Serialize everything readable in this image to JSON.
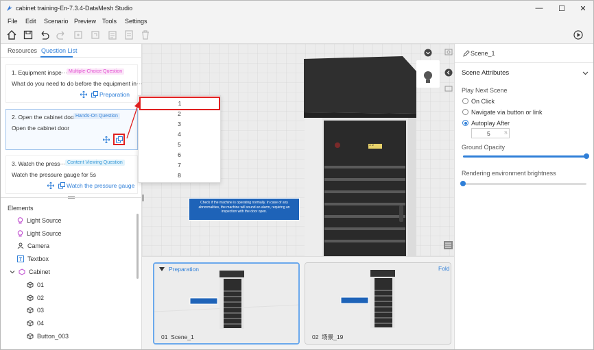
{
  "window": {
    "title": "cabinet training-En-7.3.4-DataMesh Studio",
    "minimize": "—",
    "maximize": "☐",
    "close": "✕"
  },
  "menu": [
    "File",
    "Edit",
    "Scenario",
    "Preview",
    "Tools",
    "Settings"
  ],
  "tabs": {
    "resources": "Resources",
    "question_list": "Question List"
  },
  "questions": [
    {
      "title": "1. Equipment inspe···",
      "tag": "Multiple-Choice Question",
      "text": "What do you need to do before the equipment in···",
      "action": "Preparation"
    },
    {
      "title": "2. Open the cabinet door",
      "tag": "Hands-On Question",
      "text": "Open the cabinet door",
      "action": ""
    },
    {
      "title": "3. Watch the press···",
      "tag": "Content Viewing Question",
      "text": "Watch the pressure gauge for 5s",
      "action": "Watch the pressure gauge"
    }
  ],
  "elements": {
    "header": "Elements",
    "items": [
      "Light Source",
      "Light Source",
      "Camera",
      "Textbox",
      "Cabinet",
      "01",
      "02",
      "03",
      "04",
      "Button_003"
    ]
  },
  "dropdown": [
    "1",
    "2",
    "3",
    "4",
    "5",
    "6",
    "7",
    "8"
  ],
  "viewport": {
    "info_text": "Check if the machine is operating normally. In case of any abnormalities, the machine will sound an alarm, requiring an inspection with the door open.",
    "label": "1 2"
  },
  "thumbnails": [
    {
      "tag": "Preparation",
      "caption": "01  Scene_1"
    },
    {
      "tag": "Fold",
      "caption": "02  场景_19"
    }
  ],
  "right": {
    "scene_name": "Scene_1",
    "section": "Scene Attributes",
    "play_next": "Play Next Scene",
    "options": [
      "On Click",
      "Navigate via button or link",
      "Autoplay After"
    ],
    "selected_option": "Autoplay After",
    "autoplay_value": "5",
    "autoplay_unit": "S",
    "ground_opacity": "Ground Opacity",
    "ground_opacity_value": 1.0,
    "brightness": "Rendering environment brightness",
    "brightness_value": 0.0
  },
  "colors": {
    "accent": "#2f7fd8",
    "highlight": "#e02020",
    "tag_pink": "#e24ad0",
    "tag_blue": "#3b86d8"
  }
}
